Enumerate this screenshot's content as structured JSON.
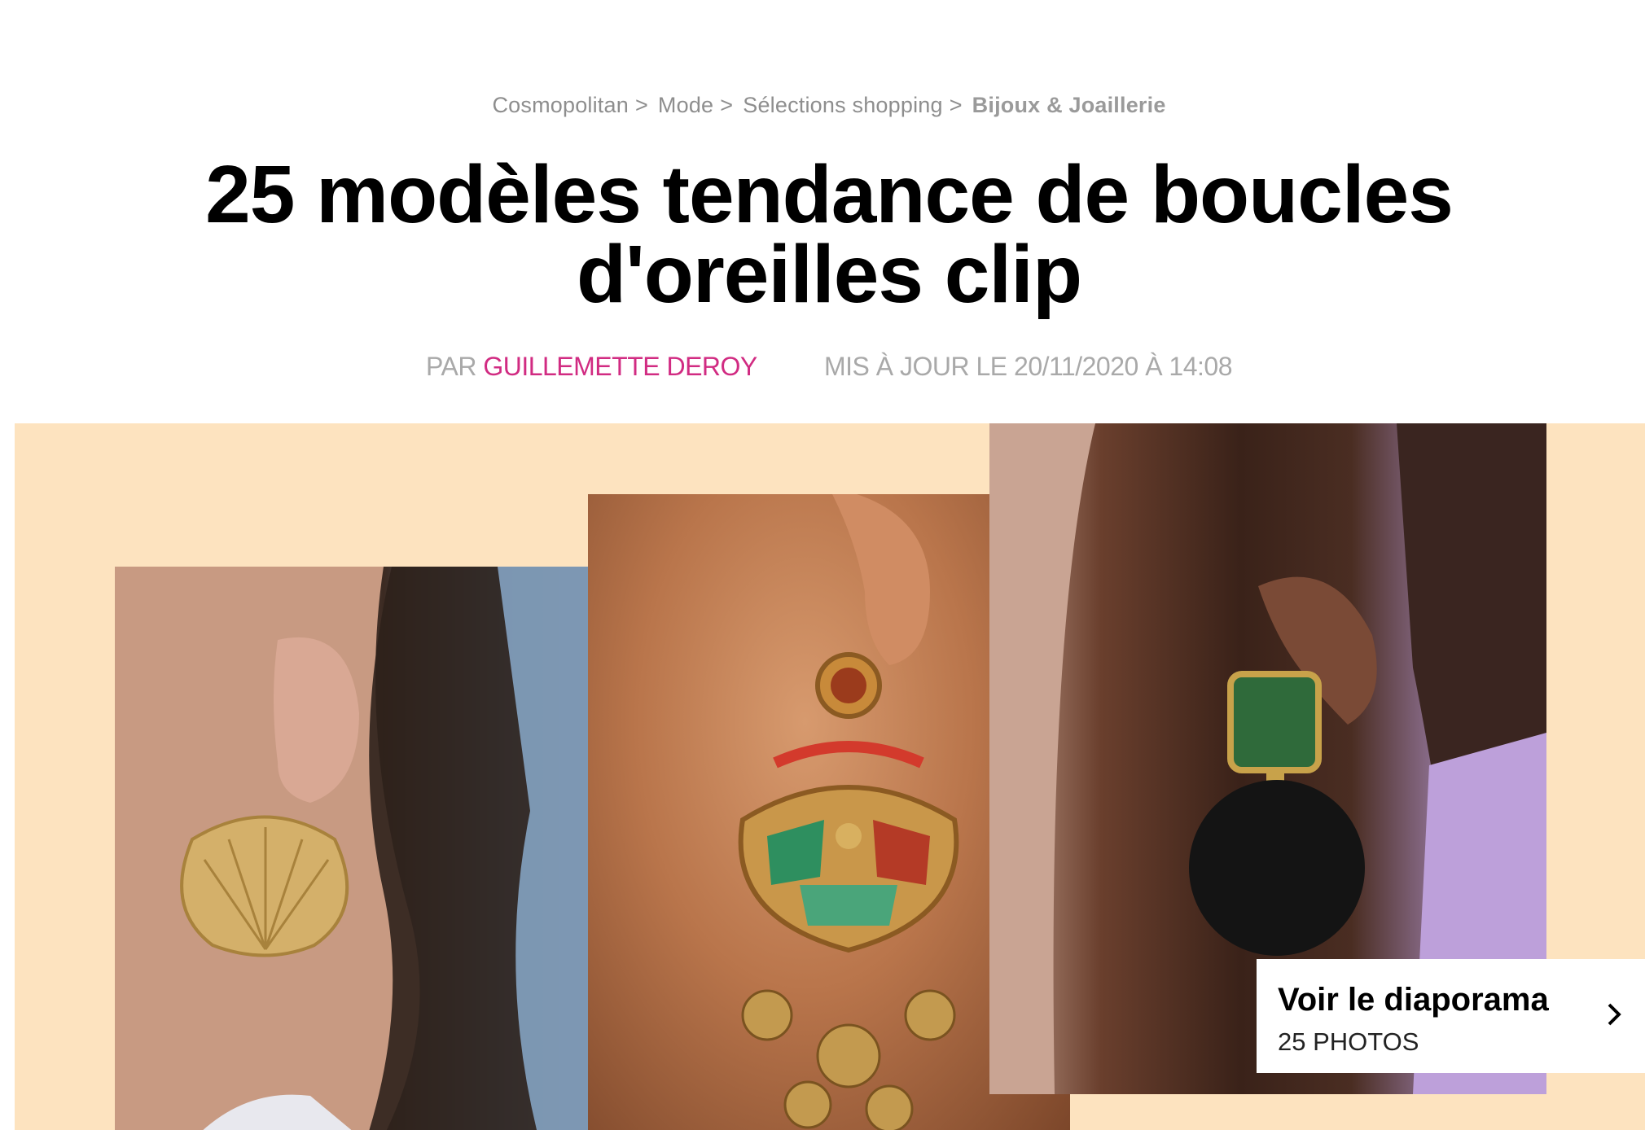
{
  "breadcrumb": {
    "items": [
      "Cosmopolitan",
      "Mode",
      "Sélections shopping"
    ],
    "separator": ">",
    "current": "Bijoux & Joaillerie"
  },
  "article": {
    "title": "25 modèles tendance de boucles d'oreilles clip",
    "by_prefix": "PAR",
    "author": "GUILLEMETTE DEROY",
    "updated": "MIS À JOUR LE 20/11/2020 À 14:08"
  },
  "hero": {
    "background_color": "#fde3bf",
    "images": [
      "gold-shell-clip-earring-photo",
      "ornate-enamel-chandelier-clip-earring-photo",
      "green-stone-black-disc-clip-earring-photo"
    ]
  },
  "slideshow": {
    "label": "Voir le diaporama",
    "count": "25 PHOTOS",
    "icon": "chevron-right-icon"
  },
  "colors": {
    "author": "#d12b82",
    "meta": "#a9a9a9",
    "breadcrumb": "#8e8e8e"
  }
}
